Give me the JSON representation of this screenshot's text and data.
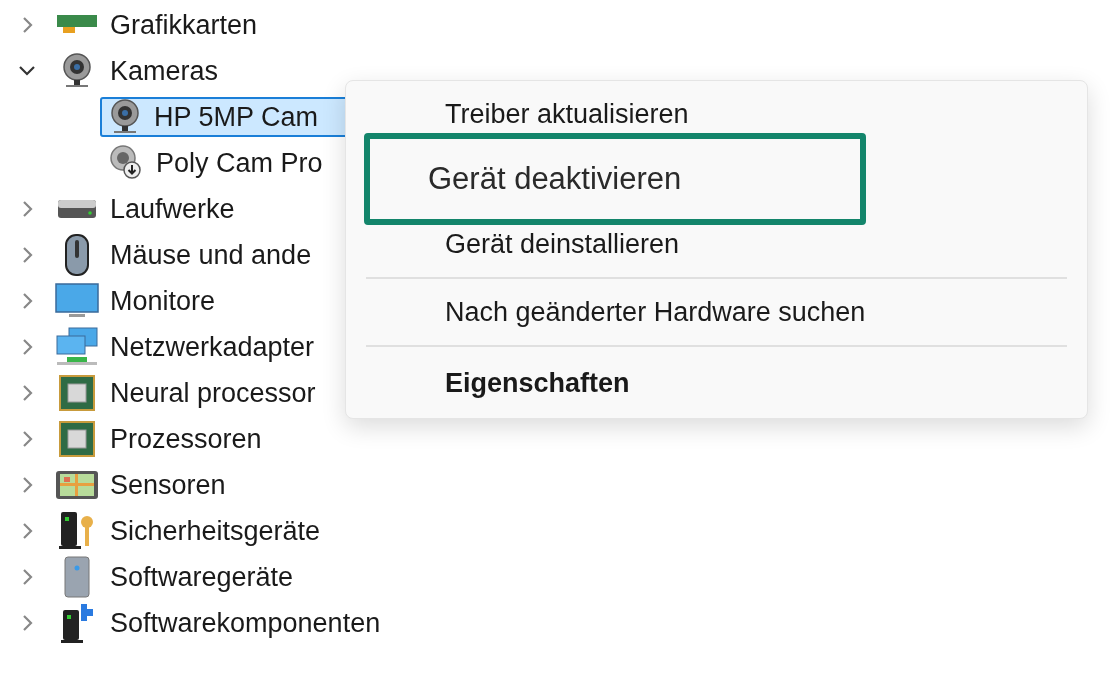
{
  "tree": [
    {
      "label": "Grafikkarten",
      "expanded": false
    },
    {
      "label": "Kameras",
      "expanded": true,
      "children": [
        {
          "label": "HP 5MP Cam",
          "selected": true
        },
        {
          "label": "Poly Cam Pro",
          "selected": false
        }
      ]
    },
    {
      "label": "Laufwerke",
      "expanded": false
    },
    {
      "label": "Mäuse und ande",
      "expanded": false
    },
    {
      "label": "Monitore",
      "expanded": false
    },
    {
      "label": "Netzwerkadapter",
      "expanded": false
    },
    {
      "label": "Neural processor",
      "expanded": false
    },
    {
      "label": "Prozessoren",
      "expanded": false
    },
    {
      "label": "Sensoren",
      "expanded": false
    },
    {
      "label": "Sicherheitsgeräte",
      "expanded": false
    },
    {
      "label": "Softwaregeräte",
      "expanded": false
    },
    {
      "label": "Softwarekomponenten",
      "expanded": false
    }
  ],
  "context_menu": [
    {
      "kind": "item",
      "label": "Treiber aktualisieren"
    },
    {
      "kind": "callout",
      "label": "Gerät deaktivieren"
    },
    {
      "kind": "item",
      "label": "Gerät deinstallieren"
    },
    {
      "kind": "separator"
    },
    {
      "kind": "item",
      "label": "Nach geänderter Hardware suchen"
    },
    {
      "kind": "separator"
    },
    {
      "kind": "default",
      "label": "Eigenschaften"
    }
  ]
}
